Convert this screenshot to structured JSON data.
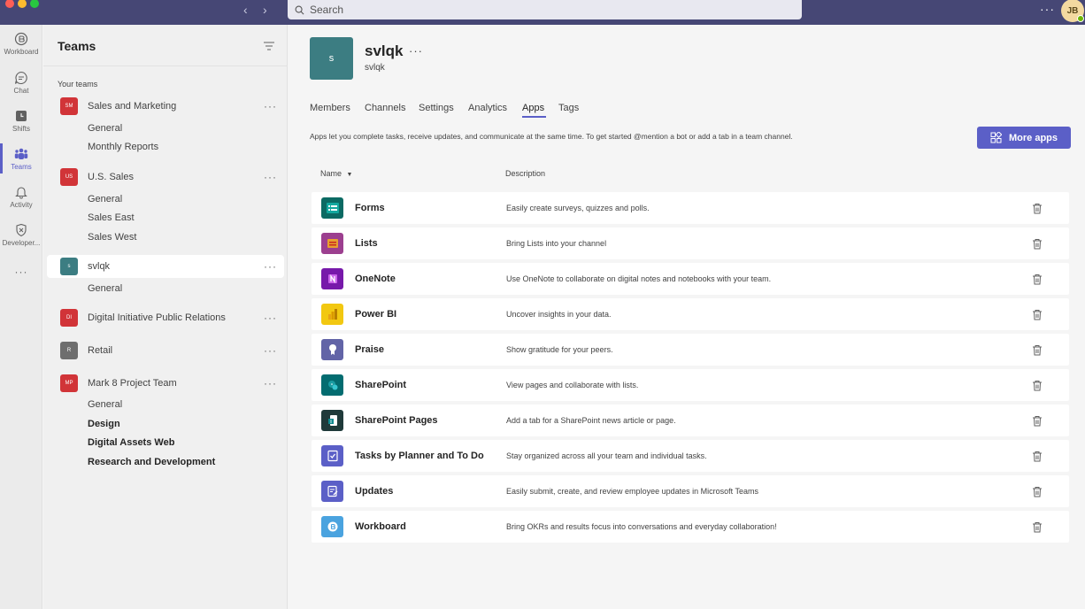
{
  "titlebar": {
    "search_placeholder": "Search",
    "more_label": "···",
    "avatar_initials": "JB",
    "nav_back": "‹",
    "nav_forward": "›"
  },
  "rail": {
    "items": [
      {
        "label": "Workboard",
        "icon": "workboard-icon"
      },
      {
        "label": "Chat",
        "icon": "chat-icon"
      },
      {
        "label": "Shifts",
        "icon": "shifts-icon"
      },
      {
        "label": "Teams",
        "icon": "teams-icon"
      },
      {
        "label": "Activity",
        "icon": "bell-icon"
      },
      {
        "label": "Developer...",
        "icon": "developer-icon"
      }
    ],
    "more_label": "···"
  },
  "teams_pane": {
    "title": "Teams",
    "section_label": "Your teams",
    "more_label": "···",
    "teams": [
      {
        "initials": "SM",
        "name": "Sales and Marketing",
        "color": "#d13438",
        "channels": [
          "General",
          "Monthly Reports"
        ]
      },
      {
        "initials": "US",
        "name": "U.S. Sales",
        "color": "#d13438",
        "channels": [
          "General",
          "Sales East",
          "Sales West"
        ]
      },
      {
        "initials": "s",
        "name": "svlqk",
        "color": "#3c7d82",
        "channels": [
          "General"
        ]
      },
      {
        "initials": "DI",
        "name": "Digital Initiative Public Relations",
        "color": "#d13438",
        "channels": []
      },
      {
        "initials": "R",
        "name": "Retail",
        "color": "#6e6e6e",
        "channels": []
      },
      {
        "initials": "MP",
        "name": "Mark 8 Project Team",
        "color": "#d13438",
        "channels": [
          "General",
          "Design",
          "Digital Assets Web",
          "Research and Development"
        ]
      }
    ]
  },
  "main": {
    "team_initial": "s",
    "team_name": "svlqk",
    "title_more": "···",
    "team_subtitle": "svlqk",
    "tabs": [
      "Members",
      "Channels",
      "Settings",
      "Analytics",
      "Apps",
      "Tags"
    ],
    "active_tab": "Apps",
    "info_text": "Apps let you complete tasks, receive updates, and communicate at the same time. To get started @mention a bot or add a tab in a team channel.",
    "more_apps_label": "More apps",
    "col_name": "Name",
    "col_description": "Description",
    "apps": [
      {
        "name": "Forms",
        "description": "Easily create surveys, quizzes and polls.",
        "icon": "forms-icon",
        "color": "#0b6a63"
      },
      {
        "name": "Lists",
        "description": "Bring Lists into your channel",
        "icon": "lists-icon",
        "color": "#9c3f8f"
      },
      {
        "name": "OneNote",
        "description": "Use OneNote to collaborate on digital notes and notebooks with your team.",
        "icon": "onenote-icon",
        "color": "#7719aa"
      },
      {
        "name": "Power BI",
        "description": "Uncover insights in your data.",
        "icon": "powerbi-icon",
        "color": "#f2c811"
      },
      {
        "name": "Praise",
        "description": "Show gratitude for your peers.",
        "icon": "praise-icon",
        "color": "#6264a7"
      },
      {
        "name": "SharePoint",
        "description": "View pages and collaborate with lists.",
        "icon": "sharepoint-icon",
        "color": "#036c70"
      },
      {
        "name": "SharePoint Pages",
        "description": "Add a tab for a SharePoint news article or page.",
        "icon": "sharepoint-pages-icon",
        "color": "#1f3a3a"
      },
      {
        "name": "Tasks by Planner and To Do",
        "description": "Stay organized across all your team and individual tasks.",
        "icon": "tasks-icon",
        "color": "#5b5fc7"
      },
      {
        "name": "Updates",
        "description": "Easily submit, create, and review employee updates in Microsoft Teams",
        "icon": "updates-icon",
        "color": "#5b5fc7"
      },
      {
        "name": "Workboard",
        "description": "Bring OKRs and results focus into conversations and everyday collaboration!",
        "icon": "workboard-app-icon",
        "color": "#4aa3df"
      }
    ]
  },
  "colors": {
    "titlebar": "#464775",
    "accent": "#5b5fc7"
  }
}
